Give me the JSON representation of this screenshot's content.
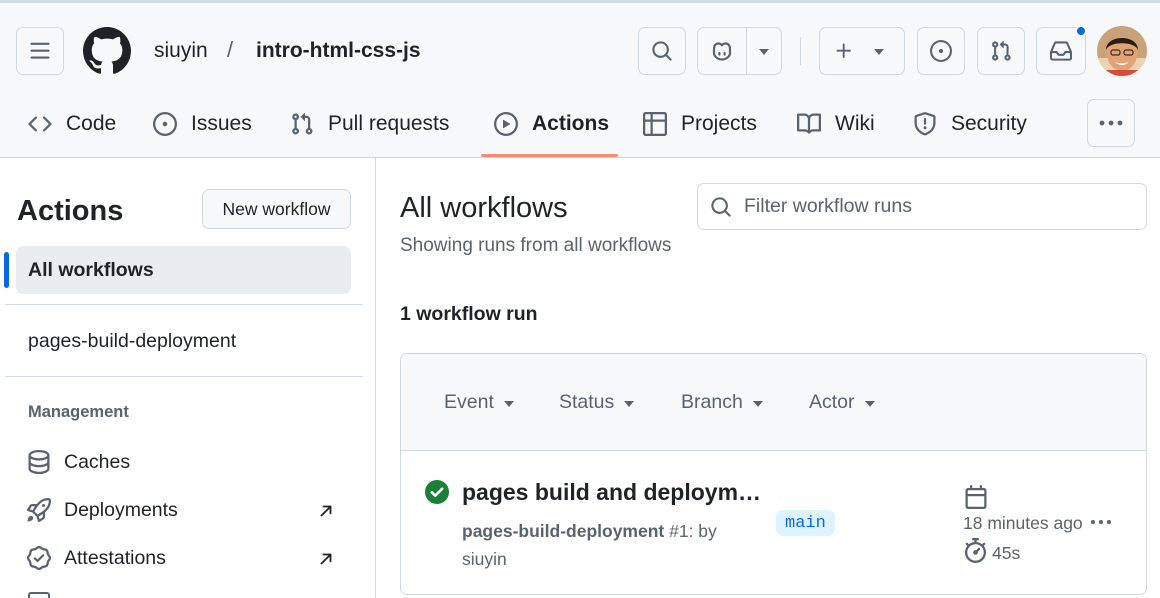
{
  "header": {
    "owner": "siuyin",
    "separator": "/",
    "repo": "intro-html-css-js",
    "icons": [
      "hamburger-icon",
      "github-logo",
      "search-icon",
      "copilot-icon",
      "plus-icon",
      "issue-opened-icon",
      "git-pull-request-icon",
      "inbox-icon",
      "kebab-horizontal-icon"
    ],
    "notification_dot_color": "#0969da"
  },
  "tabs": [
    {
      "label": "Code",
      "icon": "code-icon"
    },
    {
      "label": "Issues",
      "icon": "issue-opened-icon"
    },
    {
      "label": "Pull requests",
      "icon": "git-pull-request-icon"
    },
    {
      "label": "Actions",
      "icon": "play-icon",
      "active": true
    },
    {
      "label": "Projects",
      "icon": "table-icon"
    },
    {
      "label": "Wiki",
      "icon": "book-icon"
    },
    {
      "label": "Security",
      "icon": "shield-icon"
    }
  ],
  "sidebar": {
    "title": "Actions",
    "new_workflow_label": "New workflow",
    "all_workflows_label": "All workflows",
    "workflows": [
      "pages-build-deployment"
    ],
    "management_heading": "Management",
    "management_items": [
      {
        "label": "Caches",
        "icon": "database-icon"
      },
      {
        "label": "Deployments",
        "icon": "rocket-icon",
        "external": true
      },
      {
        "label": "Attestations",
        "icon": "verified-icon",
        "external": true
      }
    ]
  },
  "main": {
    "title": "All workflows",
    "subtitle": "Showing runs from all workflows",
    "filter_placeholder": "Filter workflow runs",
    "run_count": "1 workflow run",
    "filters": [
      "Event",
      "Status",
      "Branch",
      "Actor"
    ],
    "runs": [
      {
        "status": "success",
        "title": "pages build and deployment",
        "workflow": "pages-build-deployment",
        "run_number": "#1",
        "by_prefix": ": by",
        "actor": "siuyin",
        "branch": "main",
        "time_ago": "18 minutes ago",
        "duration": "45s"
      }
    ]
  },
  "colors": {
    "accent": "#0969da",
    "active_tab_underline": "#fd8c73",
    "success": "#1a7f37",
    "branch_bg": "#ddf4ff"
  }
}
